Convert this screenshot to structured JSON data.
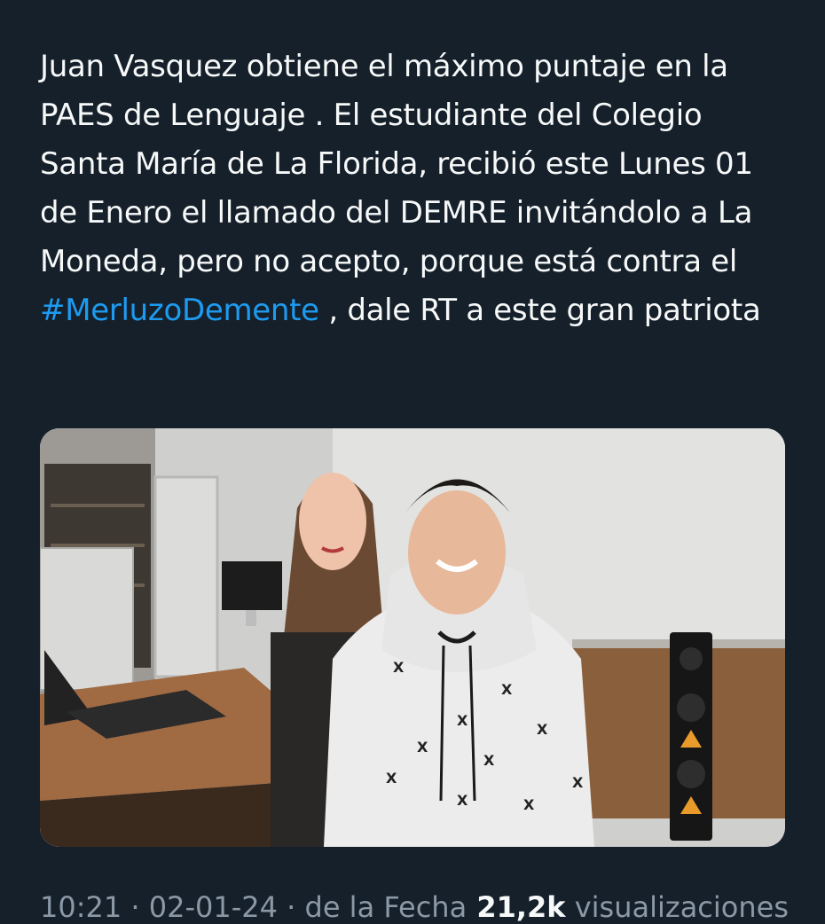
{
  "tweet": {
    "text_before": "Juan Vasquez obtiene el máximo puntaje en la PAES de Lenguaje . El estudiante del Colegio Santa María de La Florida, recibió este Lunes 01 de Enero el llamado del DEMRE invitándolo a La Moneda, pero no acepto, porque está contra el ",
    "hashtag": "#MerluzoDemente",
    "text_after": " , dale RT a este gran patriota"
  },
  "colors": {
    "background": "#15202b",
    "text": "#f7f9f9",
    "link": "#1d9bf0",
    "muted": "#8b98a5"
  },
  "media": {
    "icon": "photo-icon",
    "hoodie_mark": "X"
  },
  "meta": {
    "time_partial": "10:21 · 02-01-24 · ",
    "client_partial": "de la Fecha",
    "views_partial": " 21,2k",
    "views_label_partial": " visualizaciones"
  }
}
